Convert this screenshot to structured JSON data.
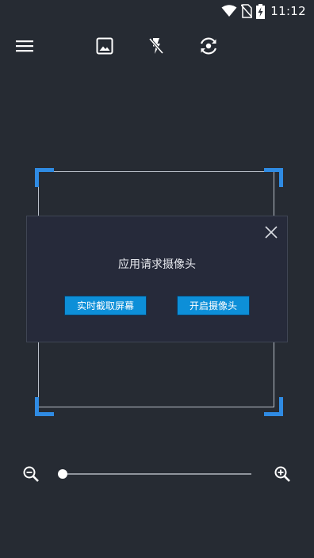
{
  "status_bar": {
    "time": "11:12",
    "icons": [
      "wifi-icon",
      "no-sim-icon",
      "battery-charging-icon"
    ]
  },
  "toolbar": {
    "icons": [
      "menu-icon",
      "image-icon",
      "flash-off-icon",
      "switch-camera-icon"
    ]
  },
  "dialog": {
    "message": "应用请求摄像头",
    "screen_capture_label": "实时截取屏幕",
    "open_camera_label": "开启摄像头",
    "close_icon": "close-icon"
  },
  "zoom": {
    "out_icon": "zoom-out-icon",
    "in_icon": "zoom-in-icon",
    "level": 0
  },
  "colors": {
    "background": "#262b33",
    "accent": "#2f8be3",
    "button": "#0d8fd8",
    "dialog": "#262a3a"
  }
}
